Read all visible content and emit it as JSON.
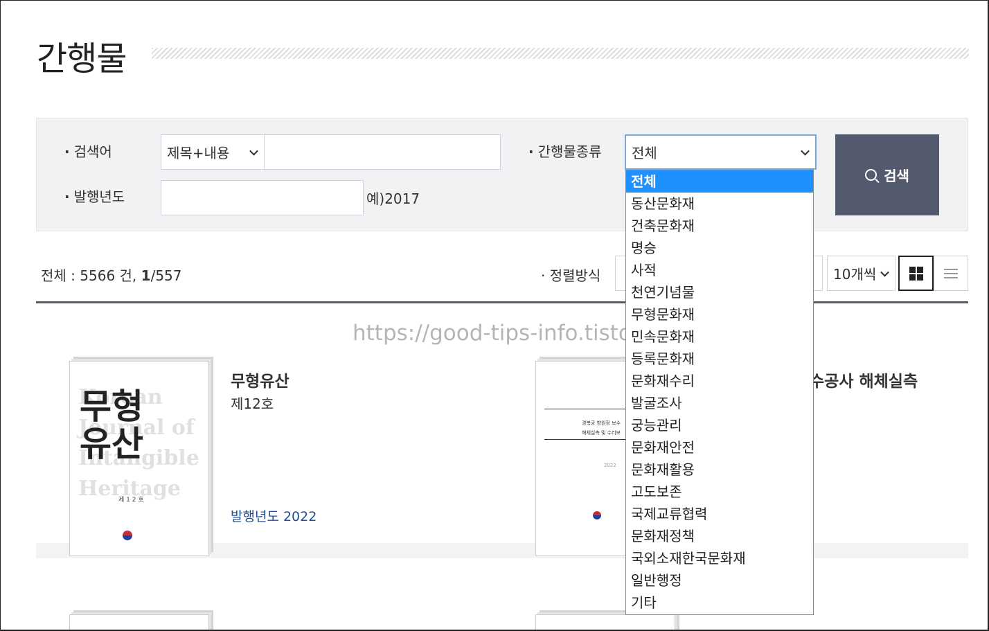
{
  "header": {
    "title": "간행물"
  },
  "search": {
    "keyword_label": "검색어",
    "year_label": "발행년도",
    "type_label": "간행물종류",
    "scope_value": "제목+내용",
    "keyword_value": "",
    "year_value": "",
    "year_hint": "예)2017",
    "type_value": "전체",
    "button_label": "검색"
  },
  "results": {
    "total_prefix": "전체 : ",
    "total_count": "5566",
    "total_unit": " 건, ",
    "current_page": "1",
    "total_pages": "/557",
    "sort_label": "정렬방식",
    "per_page": "10개씩"
  },
  "watermark": "https://good-tips-info.tistory.com/",
  "cards": [
    {
      "title": "무형유산",
      "subtitle": "제12호",
      "year": "발행년도 2022",
      "cover": {
        "bg_text": "Korean\nJournal of\nIntangible\nHeritage",
        "han": "무형\n유산",
        "no": "제 1 2 호"
      }
    },
    {
      "title": "수공사 해체실측",
      "cover": {
        "text": "경복궁 향원정 보수\n해체실측 및 수리보",
        "year": "2022"
      }
    }
  ],
  "dropdown": {
    "items": [
      "전체",
      "동산문화재",
      "건축문화재",
      "명승",
      "사적",
      "천연기념물",
      "무형문화재",
      "민속문화재",
      "등록문화재",
      "문화재수리",
      "발굴조사",
      "궁능관리",
      "문화재안전",
      "문화재활용",
      "고도보존",
      "국제교류협력",
      "문화재정책",
      "국외소재한국문화재",
      "일반행정",
      "기타"
    ],
    "selected_index": 0
  },
  "colors": {
    "button_bg": "#545a6e",
    "selected_bg": "#1e90ff",
    "year_link": "#1f4f93"
  }
}
